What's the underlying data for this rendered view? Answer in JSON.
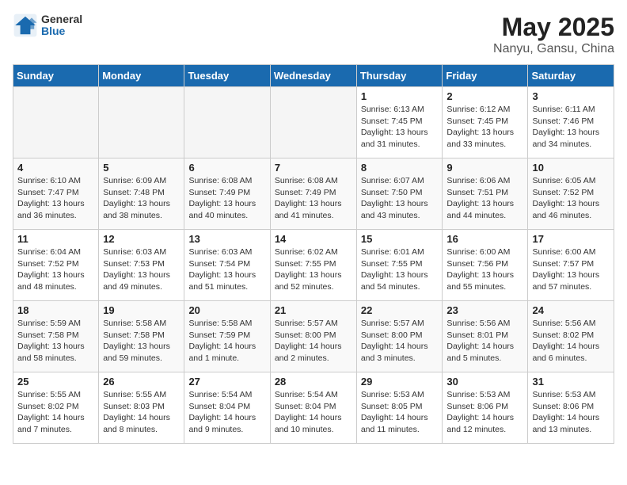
{
  "header": {
    "logo_general": "General",
    "logo_blue": "Blue",
    "title": "May 2025",
    "subtitle": "Nanyu, Gansu, China"
  },
  "days_of_week": [
    "Sunday",
    "Monday",
    "Tuesday",
    "Wednesday",
    "Thursday",
    "Friday",
    "Saturday"
  ],
  "weeks": [
    [
      {
        "day": "",
        "info": ""
      },
      {
        "day": "",
        "info": ""
      },
      {
        "day": "",
        "info": ""
      },
      {
        "day": "",
        "info": ""
      },
      {
        "day": "1",
        "info": "Sunrise: 6:13 AM\nSunset: 7:45 PM\nDaylight: 13 hours and 31 minutes."
      },
      {
        "day": "2",
        "info": "Sunrise: 6:12 AM\nSunset: 7:45 PM\nDaylight: 13 hours and 33 minutes."
      },
      {
        "day": "3",
        "info": "Sunrise: 6:11 AM\nSunset: 7:46 PM\nDaylight: 13 hours and 34 minutes."
      }
    ],
    [
      {
        "day": "4",
        "info": "Sunrise: 6:10 AM\nSunset: 7:47 PM\nDaylight: 13 hours and 36 minutes."
      },
      {
        "day": "5",
        "info": "Sunrise: 6:09 AM\nSunset: 7:48 PM\nDaylight: 13 hours and 38 minutes."
      },
      {
        "day": "6",
        "info": "Sunrise: 6:08 AM\nSunset: 7:49 PM\nDaylight: 13 hours and 40 minutes."
      },
      {
        "day": "7",
        "info": "Sunrise: 6:08 AM\nSunset: 7:49 PM\nDaylight: 13 hours and 41 minutes."
      },
      {
        "day": "8",
        "info": "Sunrise: 6:07 AM\nSunset: 7:50 PM\nDaylight: 13 hours and 43 minutes."
      },
      {
        "day": "9",
        "info": "Sunrise: 6:06 AM\nSunset: 7:51 PM\nDaylight: 13 hours and 44 minutes."
      },
      {
        "day": "10",
        "info": "Sunrise: 6:05 AM\nSunset: 7:52 PM\nDaylight: 13 hours and 46 minutes."
      }
    ],
    [
      {
        "day": "11",
        "info": "Sunrise: 6:04 AM\nSunset: 7:52 PM\nDaylight: 13 hours and 48 minutes."
      },
      {
        "day": "12",
        "info": "Sunrise: 6:03 AM\nSunset: 7:53 PM\nDaylight: 13 hours and 49 minutes."
      },
      {
        "day": "13",
        "info": "Sunrise: 6:03 AM\nSunset: 7:54 PM\nDaylight: 13 hours and 51 minutes."
      },
      {
        "day": "14",
        "info": "Sunrise: 6:02 AM\nSunset: 7:55 PM\nDaylight: 13 hours and 52 minutes."
      },
      {
        "day": "15",
        "info": "Sunrise: 6:01 AM\nSunset: 7:55 PM\nDaylight: 13 hours and 54 minutes."
      },
      {
        "day": "16",
        "info": "Sunrise: 6:00 AM\nSunset: 7:56 PM\nDaylight: 13 hours and 55 minutes."
      },
      {
        "day": "17",
        "info": "Sunrise: 6:00 AM\nSunset: 7:57 PM\nDaylight: 13 hours and 57 minutes."
      }
    ],
    [
      {
        "day": "18",
        "info": "Sunrise: 5:59 AM\nSunset: 7:58 PM\nDaylight: 13 hours and 58 minutes."
      },
      {
        "day": "19",
        "info": "Sunrise: 5:58 AM\nSunset: 7:58 PM\nDaylight: 13 hours and 59 minutes."
      },
      {
        "day": "20",
        "info": "Sunrise: 5:58 AM\nSunset: 7:59 PM\nDaylight: 14 hours and 1 minute."
      },
      {
        "day": "21",
        "info": "Sunrise: 5:57 AM\nSunset: 8:00 PM\nDaylight: 14 hours and 2 minutes."
      },
      {
        "day": "22",
        "info": "Sunrise: 5:57 AM\nSunset: 8:00 PM\nDaylight: 14 hours and 3 minutes."
      },
      {
        "day": "23",
        "info": "Sunrise: 5:56 AM\nSunset: 8:01 PM\nDaylight: 14 hours and 5 minutes."
      },
      {
        "day": "24",
        "info": "Sunrise: 5:56 AM\nSunset: 8:02 PM\nDaylight: 14 hours and 6 minutes."
      }
    ],
    [
      {
        "day": "25",
        "info": "Sunrise: 5:55 AM\nSunset: 8:02 PM\nDaylight: 14 hours and 7 minutes."
      },
      {
        "day": "26",
        "info": "Sunrise: 5:55 AM\nSunset: 8:03 PM\nDaylight: 14 hours and 8 minutes."
      },
      {
        "day": "27",
        "info": "Sunrise: 5:54 AM\nSunset: 8:04 PM\nDaylight: 14 hours and 9 minutes."
      },
      {
        "day": "28",
        "info": "Sunrise: 5:54 AM\nSunset: 8:04 PM\nDaylight: 14 hours and 10 minutes."
      },
      {
        "day": "29",
        "info": "Sunrise: 5:53 AM\nSunset: 8:05 PM\nDaylight: 14 hours and 11 minutes."
      },
      {
        "day": "30",
        "info": "Sunrise: 5:53 AM\nSunset: 8:06 PM\nDaylight: 14 hours and 12 minutes."
      },
      {
        "day": "31",
        "info": "Sunrise: 5:53 AM\nSunset: 8:06 PM\nDaylight: 14 hours and 13 minutes."
      }
    ]
  ]
}
